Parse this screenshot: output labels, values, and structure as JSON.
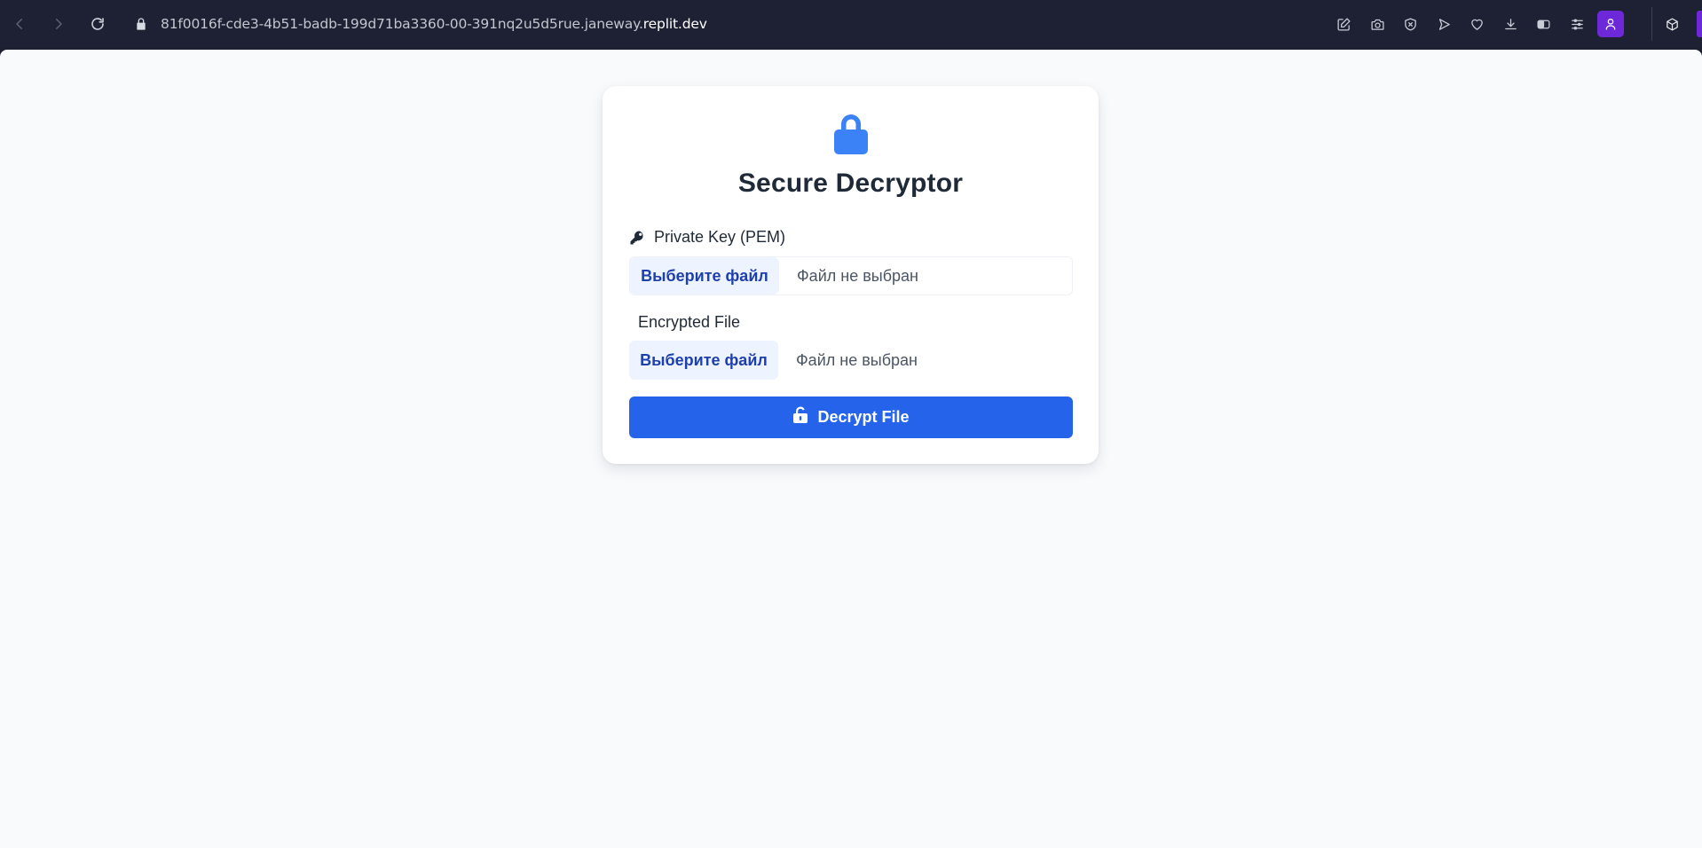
{
  "browser": {
    "url_subdomain": "81f0016f-cde3-4b51-badb-199d71ba3360-00-391nq2u5d5rue.janeway.",
    "url_host": "replit.dev",
    "toolbar_icons": [
      "edit-icon",
      "camera-icon",
      "shield-icon",
      "send-icon",
      "heart-icon",
      "download-icon",
      "battery-icon",
      "menu-icon",
      "profile-icon",
      "cube-icon"
    ]
  },
  "app": {
    "title": "Secure Decryptor",
    "private_key": {
      "label": "Private Key (PEM)",
      "button_label": "Выберите файл",
      "status": "Файл не выбран"
    },
    "encrypted_file": {
      "label": "Encrypted File",
      "button_label": "Выберите файл",
      "status": "Файл не выбран"
    },
    "decrypt_button_label": "Decrypt File",
    "colors": {
      "accent": "#2563eb",
      "lock_icon": "#3b82f6",
      "file_button_bg": "#eef4ff",
      "file_button_text": "#1e40af",
      "page_bg": "#f8fafc",
      "browser_chrome": "#1d2133",
      "profile": "#6d28d9"
    }
  }
}
